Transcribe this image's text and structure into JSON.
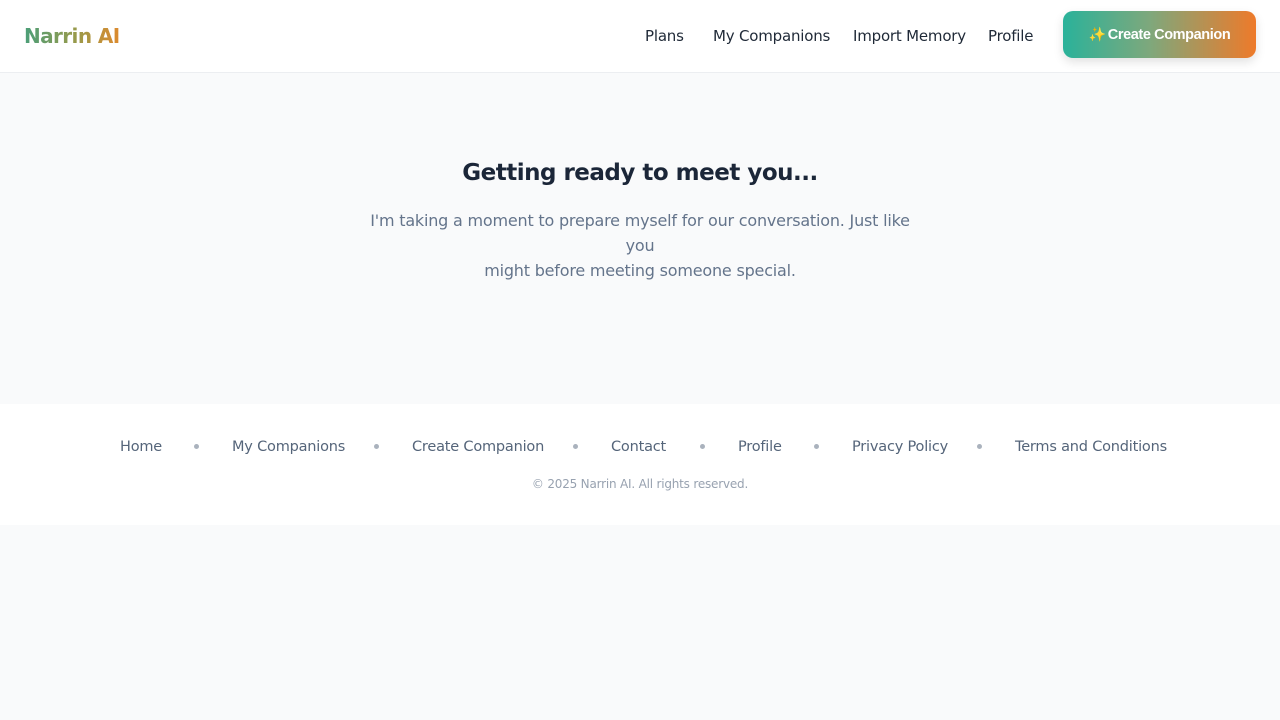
{
  "header": {
    "logo": "Narrin AI",
    "nav": {
      "plans": "Plans",
      "my_companions": "My Companions",
      "import_memory": "Import Memory",
      "profile": "Profile"
    },
    "cta": {
      "icon": "✨",
      "label": "Create Companion"
    }
  },
  "main": {
    "title": "Getting ready to meet you...",
    "subtitle_line1": "I'm taking a moment to prepare myself for our conversation. Just like you",
    "subtitle_line2": "might before meeting someone special."
  },
  "footer": {
    "links": [
      "Home",
      "My Companions",
      "Create Companion",
      "Contact",
      "Profile",
      "Privacy Policy",
      "Terms and Conditions"
    ],
    "copyright": "© 2025 Narrin AI. All rights reserved."
  },
  "colors": {
    "accent_teal": "#2ab29a",
    "accent_orange": "#ee7a2a",
    "title": "#1b2638",
    "muted": "#64748b"
  }
}
